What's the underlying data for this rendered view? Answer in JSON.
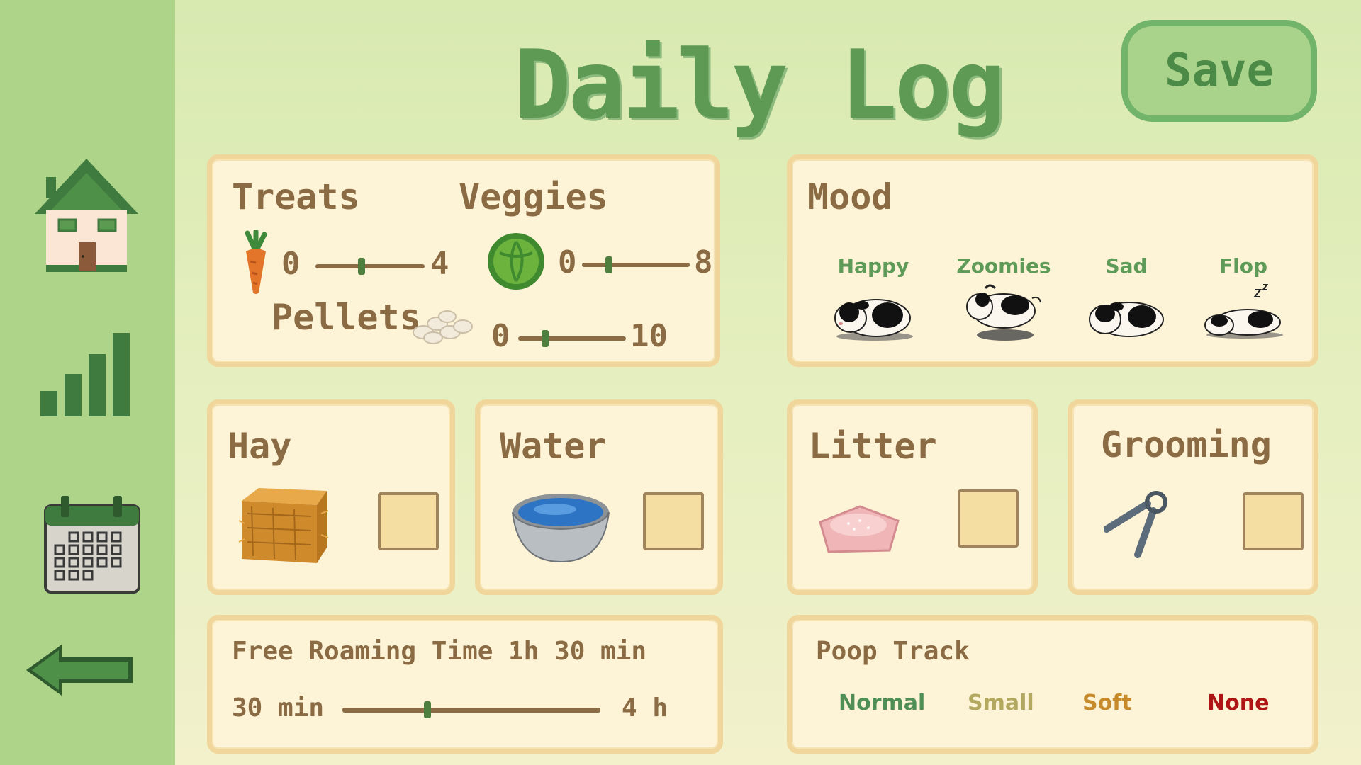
{
  "header": {
    "title": "Daily Log",
    "save_label": "Save"
  },
  "sidebar": {
    "items": [
      {
        "icon": "house-icon",
        "label": "Home"
      },
      {
        "icon": "bar-chart-icon",
        "label": "Stats"
      },
      {
        "icon": "calendar-icon",
        "label": "Calendar"
      },
      {
        "icon": "back-arrow-icon",
        "label": "Back"
      }
    ]
  },
  "food": {
    "treats": {
      "label": "Treats",
      "min": "0",
      "max": "4",
      "value_fraction": 0.42
    },
    "veggies": {
      "label": "Veggies",
      "min": "0",
      "max": "8",
      "value_fraction": 0.25
    },
    "pellets": {
      "label": "Pellets",
      "min": "0",
      "max": "10",
      "value_fraction": 0.25
    }
  },
  "mood": {
    "title": "Mood",
    "options": [
      {
        "label": "Happy"
      },
      {
        "label": "Zoomies"
      },
      {
        "label": "Sad"
      },
      {
        "label": "Flop"
      }
    ]
  },
  "chores": {
    "hay": {
      "label": "Hay",
      "checked": false
    },
    "water": {
      "label": "Water",
      "checked": false
    },
    "litter": {
      "label": "Litter",
      "checked": false
    },
    "grooming": {
      "label": "Grooming",
      "checked": false
    }
  },
  "roaming": {
    "label": "Free Roaming Time :",
    "value": "1h 30 min",
    "min_label": "30 min",
    "max_label": "4 h",
    "value_fraction": 0.33
  },
  "poop": {
    "title": "Poop Track",
    "options": [
      {
        "label": "Normal",
        "color": "#4f8f56"
      },
      {
        "label": "Small",
        "color": "#b3a860"
      },
      {
        "label": "Soft",
        "color": "#c78a2a"
      },
      {
        "label": "None",
        "color": "#b01515"
      }
    ]
  },
  "colors": {
    "sidebar": "#aed48a",
    "title": "#5f9a55",
    "panel": "#fdf3d6",
    "panel_border": "#f0d69a",
    "text_brown": "#8a6b44"
  }
}
